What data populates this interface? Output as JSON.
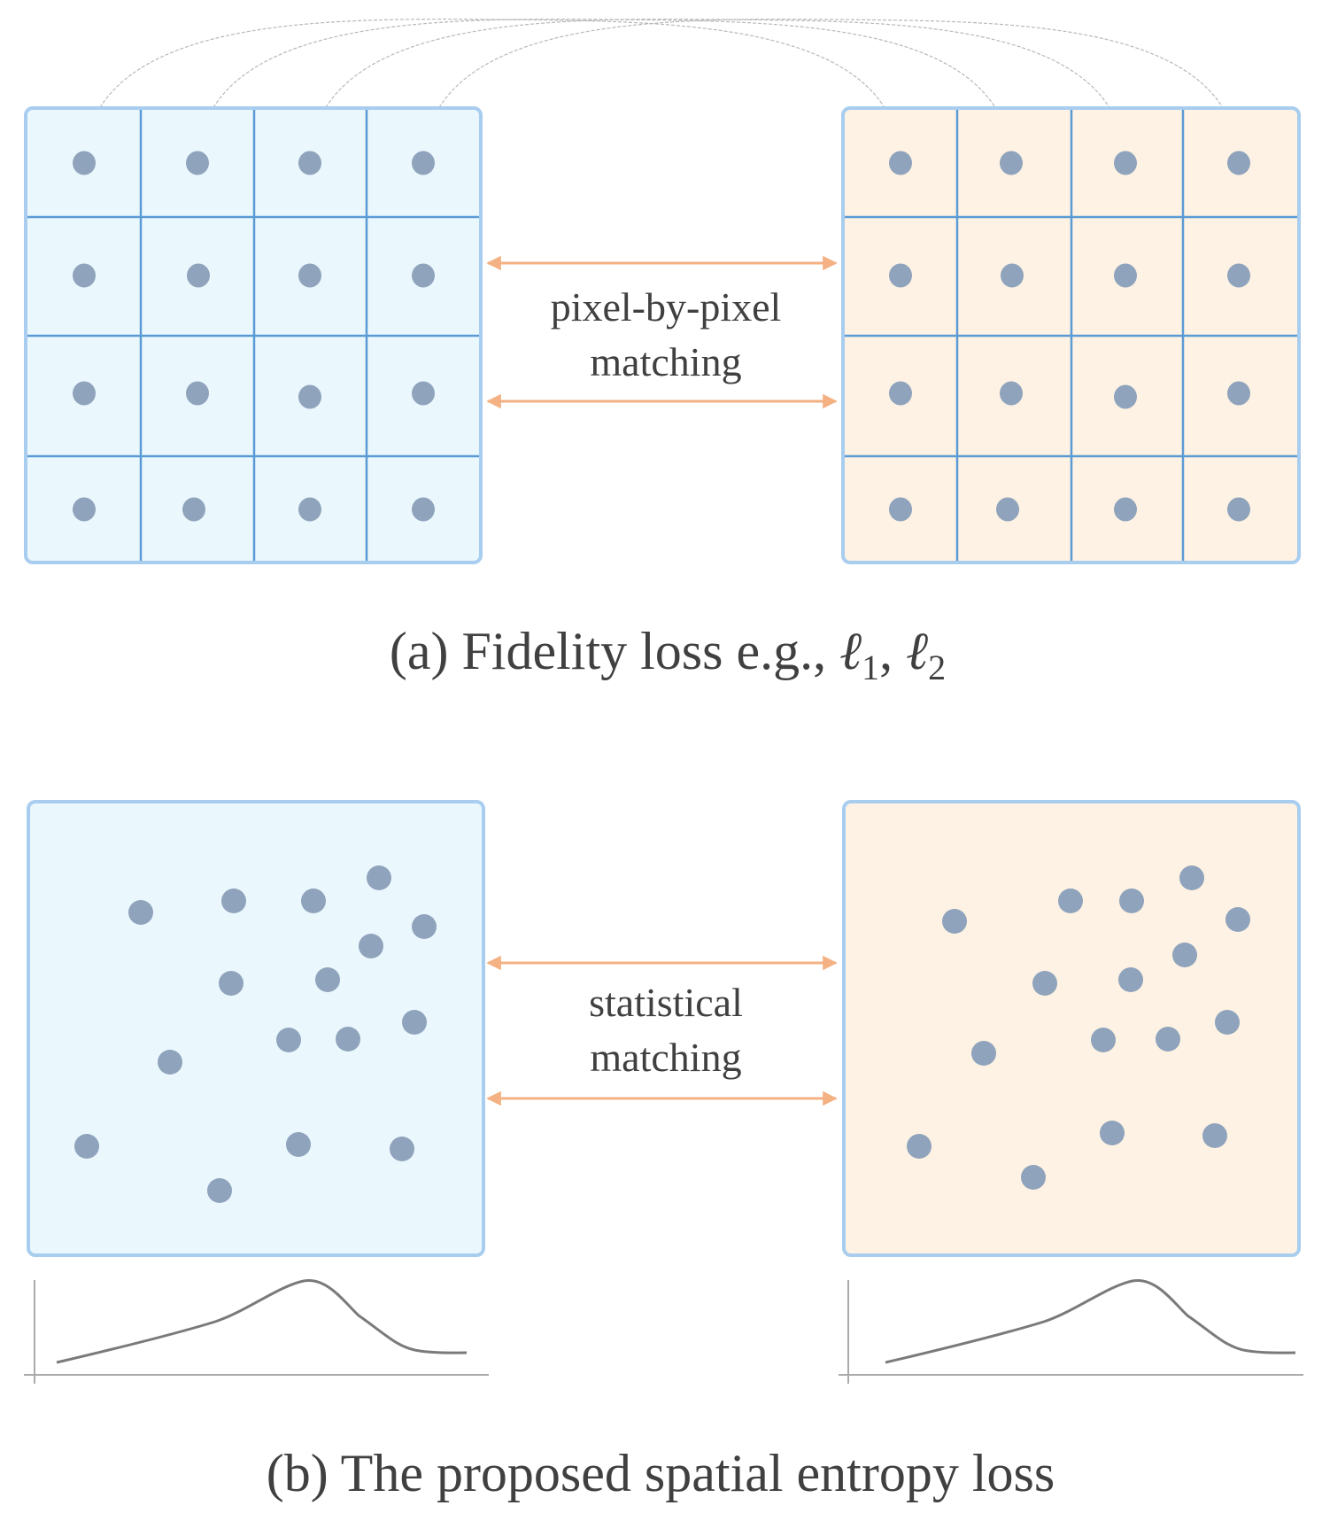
{
  "panel_a": {
    "caption_prefix": "(a) Fidelity loss e.g., ",
    "caption_math_1": "ℓ",
    "caption_sub_1": "1",
    "caption_sep": ", ",
    "caption_math_2": "ℓ",
    "caption_sub_2": "2",
    "middle_label_line1": "pixel-by-pixel",
    "middle_label_line2": "matching",
    "grid_rows": 4,
    "grid_cols": 4,
    "correspondence_links": 4
  },
  "panel_b": {
    "caption": "(b) The proposed spatial entropy loss",
    "middle_label_line1": "statistical",
    "middle_label_line2": "matching",
    "points_per_map": 16,
    "distribution_plot": "density-curve"
  },
  "colors": {
    "source_fill": "#eaf7fd",
    "target_fill": "#fdf2e3",
    "box_border": "#a8cdef",
    "grid_line": "#5b9bd5",
    "point": "#8fa3bc",
    "arrow": "#f4b183",
    "link": "#b8b8b8",
    "curve": "#7a7a7a",
    "axis": "#aaaaaa",
    "text": "#404040"
  }
}
